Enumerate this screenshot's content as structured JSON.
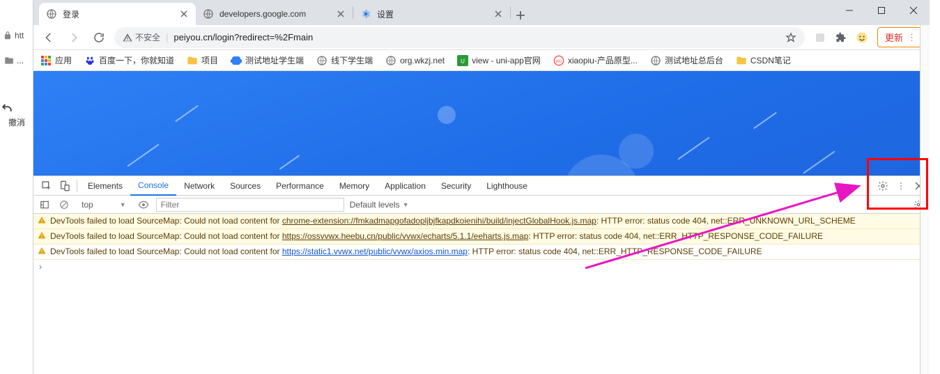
{
  "window_controls": {
    "minimize": "min",
    "maximize": "max",
    "close": "close"
  },
  "leftstrip": {
    "addr_stub": "htt",
    "undo_label": "撤消"
  },
  "tabs": [
    {
      "title": "登录",
      "active": true,
      "icon": "globe"
    },
    {
      "title": "developers.google.com",
      "active": false,
      "icon": "globe"
    },
    {
      "title": "设置",
      "active": false,
      "icon": "gear-blue"
    }
  ],
  "addressbar": {
    "security_label": "不安全",
    "url": "peiyou.cn/login?redirect=%2Fmain",
    "update_label": "更新"
  },
  "bookmarks": [
    {
      "label": "应用",
      "icon": "apps"
    },
    {
      "label": "百度一下，你就知道",
      "icon": "baidu"
    },
    {
      "label": "项目",
      "icon": "folder"
    },
    {
      "label": "测试地址学生端",
      "icon": "brain"
    },
    {
      "label": "线下学生端",
      "icon": "globe"
    },
    {
      "label": "org.wkzj.net",
      "icon": "globe"
    },
    {
      "label": "view - uni-app官网",
      "icon": "uni"
    },
    {
      "label": "xiaopiu-产品原型...",
      "icon": "piu"
    },
    {
      "label": "测试地址总后台",
      "icon": "globe"
    },
    {
      "label": "CSDN笔记",
      "icon": "folder"
    }
  ],
  "devtools": {
    "tabs": [
      "Elements",
      "Console",
      "Network",
      "Sources",
      "Performance",
      "Memory",
      "Application",
      "Security",
      "Lighthouse"
    ],
    "active_tab": "Console",
    "toolbar": {
      "context": "top",
      "filter_placeholder": "Filter",
      "levels_label": "Default levels"
    },
    "messages": [
      {
        "type": "warn",
        "prefix": "DevTools failed to load SourceMap: Could not load content for ",
        "link": "chrome-extension://fmkadmapgofadopljbjfkapdkoienihi/build/injectGlobalHook.js.map",
        "suffix": ": HTTP error: status code 404, net::ERR_UNKNOWN_URL_SCHEME"
      },
      {
        "type": "warn",
        "prefix": "DevTools failed to load SourceMap: Could not load content for ",
        "link": "https://ossvvwx.heebu.cn/public/vvwx/echarts/5.1.1/eeharts.js.map",
        "suffix": ": HTTP error: status code 404, net::ERR_HTTP_RESPONSE_CODE_FAILURE"
      },
      {
        "type": "warn-plain",
        "prefix": "DevTools failed to load SourceMap: Could not load content for ",
        "link": "https://static1.vvwx.net/public/vvwx/axios.min.map",
        "suffix": ": HTTP error: status code 404, net::ERR_HTTP_RESPONSE_CODE_FAILURE"
      }
    ]
  },
  "annotation": {
    "color": "#ff0000",
    "arrow_color": "#ff00e6"
  }
}
